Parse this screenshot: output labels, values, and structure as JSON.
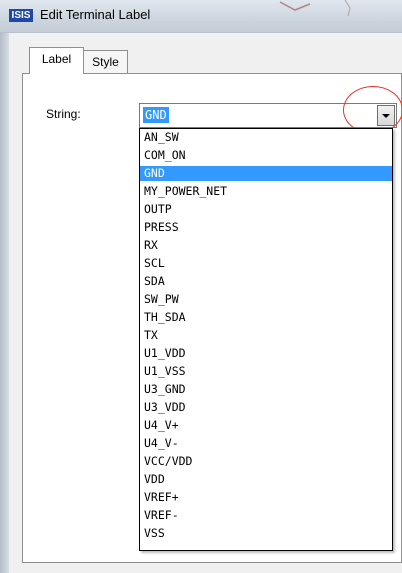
{
  "window": {
    "title": "Edit Terminal Label",
    "icon_text": "ISIS"
  },
  "tabs": [
    {
      "label": "Label",
      "active": true
    },
    {
      "label": "Style",
      "active": false
    }
  ],
  "string_field": {
    "label": "String:",
    "value": "GND"
  },
  "dropdown": {
    "selected": "GND",
    "options": [
      "AN_SW",
      "COM_ON",
      "GND",
      "MY_POWER_NET",
      "OUTP",
      "PRESS",
      "RX",
      "SCL",
      "SDA",
      "SW_PW",
      "TH_SDA",
      "TX",
      "U1_VDD",
      "U1_VSS",
      "U3_GND",
      "U3_VDD",
      "U4_V+",
      "U4_V-",
      "VCC/VDD",
      "VDD",
      "VREF+",
      "VREF-",
      "VSS"
    ]
  },
  "colors": {
    "selection": "#3399ff",
    "annotation_circle": "#e8322c",
    "icon_bg": "#1f47a6"
  }
}
